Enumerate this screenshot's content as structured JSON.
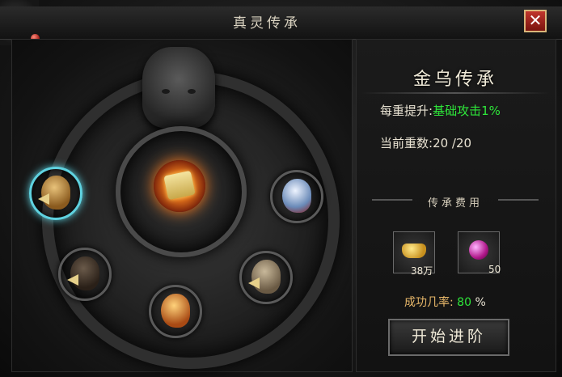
{
  "window": {
    "title": "真灵传承",
    "close_label": "✕"
  },
  "panel": {
    "name": "金乌传承",
    "per_level_label": "每重提升:",
    "per_level_value": "基础攻击1%",
    "current_level_label": "当前重数:",
    "current_level_value": "20 /20",
    "cost_title": "传承费用",
    "costs": [
      {
        "icon": "gold-ingot-icon",
        "count": "38万"
      },
      {
        "icon": "purple-gem-icon",
        "count": "50"
      }
    ],
    "success_rate_label": "成功几率:",
    "success_rate_value": "80",
    "success_rate_unit": "%",
    "start_button": "开始进阶"
  },
  "birds": [
    {
      "name": "golden-eagle",
      "selected": true
    },
    {
      "name": "white-phoenix",
      "selected": false
    },
    {
      "name": "dark-eagle",
      "selected": false
    },
    {
      "name": "grey-hawk",
      "selected": false
    },
    {
      "name": "flame-bird",
      "selected": false
    }
  ],
  "colors": {
    "accent_green": "#2ee63a",
    "selected_ring": "#5fd2e0",
    "close_red": "#c1362d"
  }
}
